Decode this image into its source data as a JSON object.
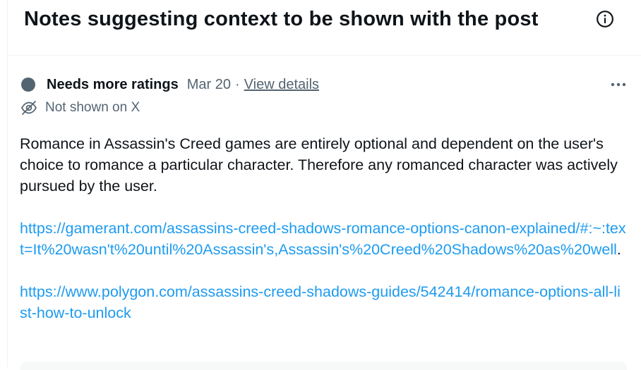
{
  "header": {
    "title": "Notes suggesting context to be shown with the post",
    "info_icon": "info-circle-icon"
  },
  "note": {
    "status": "Needs more ratings",
    "date": "Mar 20",
    "separator": "·",
    "view_details": "View details",
    "more_icon": "more-horizontal-icon",
    "visibility_icon": "eye-off-icon",
    "visibility": "Not shown on X",
    "body": {
      "text": "Romance in Assassin's Creed games are entirely optional and dependent on the user's choice to romance a particular character. Therefore any romanced character was actively pursued by the user.",
      "link1": "https://gamerant.com/assassins-creed-shadows-romance-options-canon-explained/#:~:text=It%20wasn't%20until%20Assassin's,Assassin's%20Creed%20Shadows%20as%20well",
      "link1_suffix": ".",
      "link2": "https://www.polygon.com/assassins-creed-shadows-guides/542414/romance-options-all-list-how-to-unlock"
    }
  },
  "colors": {
    "text_primary": "#0f1419",
    "text_secondary": "#536471",
    "link": "#1d9bf0",
    "border": "#eff3f4"
  }
}
